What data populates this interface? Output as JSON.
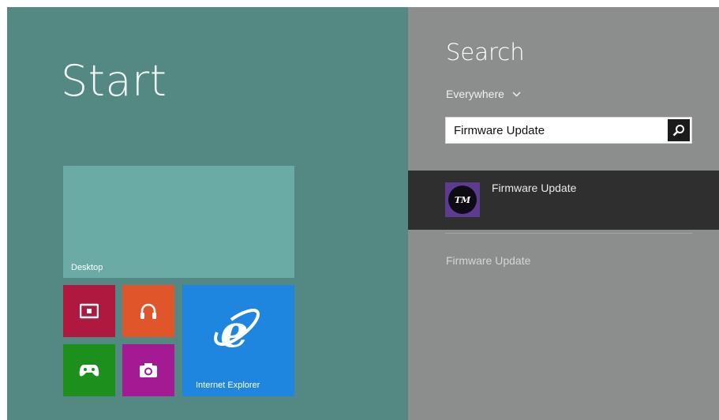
{
  "start": {
    "title": "Start",
    "tiles": {
      "desktop": "Desktop",
      "internet_explorer": "Internet Explorer"
    }
  },
  "search": {
    "title": "Search",
    "scope": "Everywhere",
    "query": "Firmware Update",
    "selected_result": {
      "icon_text": "TM",
      "title": "Firmware Update"
    },
    "plain_result": "Firmware Update"
  },
  "colors": {
    "start_background": "#548882",
    "search_background": "#8c8e8d",
    "desktop_tile": "#6aaba6",
    "video_tile": "#b0193f",
    "music_tile": "#e0552a",
    "games_tile": "#1c8f1c",
    "camera_tile": "#a31a92",
    "ie_tile": "#1f86e0",
    "selected_result": "#2f2f2f"
  },
  "icons": [
    "video-icon",
    "headphones-icon",
    "games-icon",
    "camera-icon",
    "internet-explorer-icon",
    "search-icon",
    "chevron-down-icon"
  ]
}
